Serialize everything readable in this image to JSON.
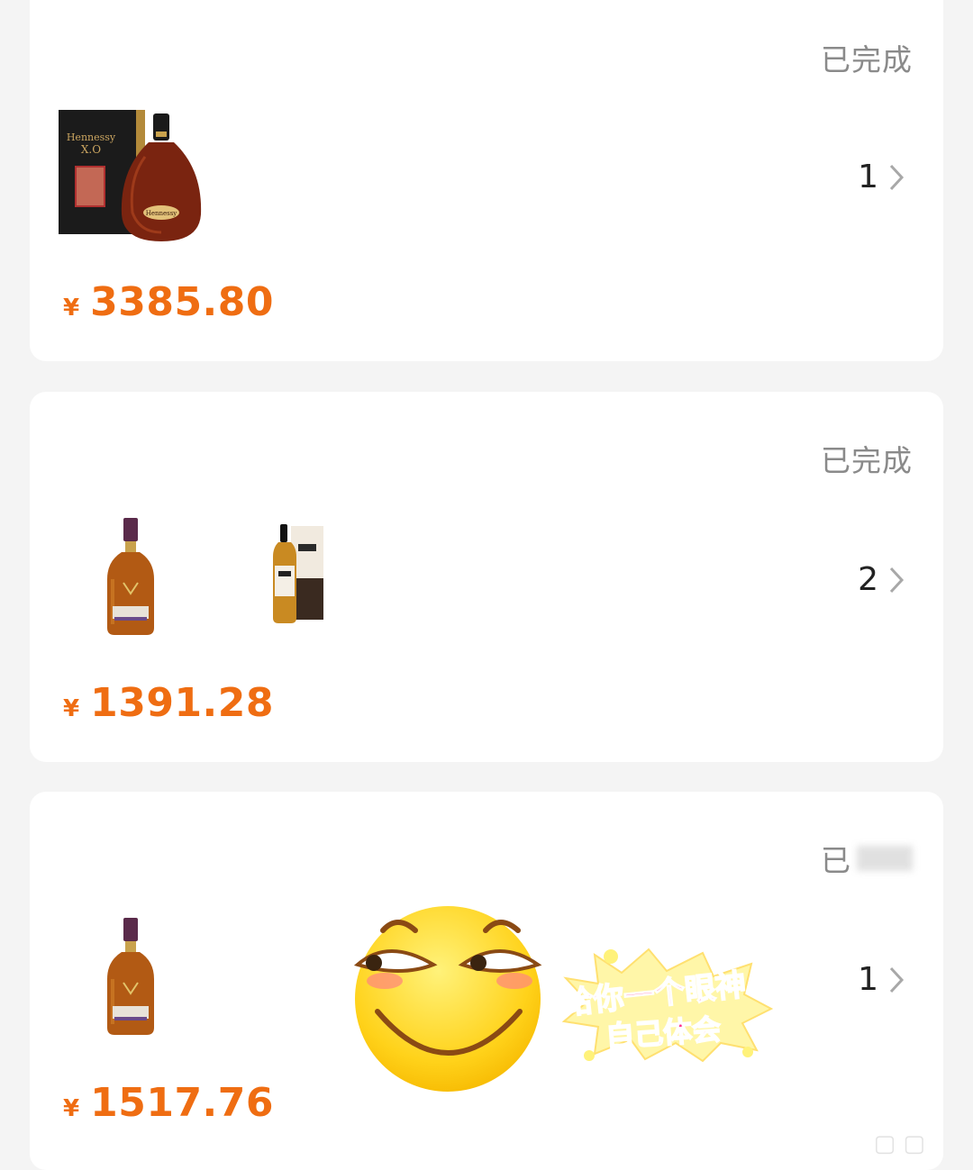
{
  "orders": [
    {
      "status": "已完成",
      "count": "1",
      "currency_symbol": "¥",
      "price": "3385.80",
      "product_icons": [
        "hennessy-xo-bottle-icon"
      ]
    },
    {
      "status": "已完成",
      "count": "2",
      "currency_symbol": "¥",
      "price": "1391.28",
      "product_icons": [
        "dalmore-whisky-bottle-icon",
        "bowmore-whisky-bottle-icon"
      ]
    },
    {
      "status": "已",
      "count": "1",
      "currency_symbol": "¥",
      "price": "1517.76",
      "product_icons": [
        "dalmore-whisky-bottle-icon"
      ]
    }
  ],
  "sticker": {
    "line1": "给你一个眼神",
    "line2": "自己体会"
  },
  "colors": {
    "price": "#ef6d12",
    "status": "#8a8a8a",
    "card": "#ffffff",
    "background": "#f4f4f4"
  }
}
